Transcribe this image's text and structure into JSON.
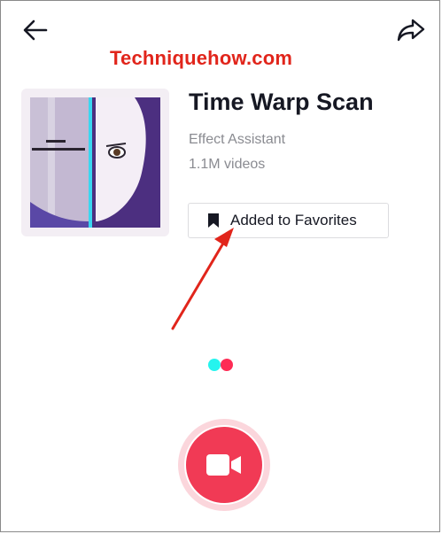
{
  "watermark": "Techniquehow.com",
  "effect": {
    "title": "Time Warp Scan",
    "creator": "Effect Assistant",
    "video_count": "1.1M videos"
  },
  "favorite_button": {
    "label": "Added to Favorites",
    "state": "added"
  },
  "icons": {
    "back": "arrow-left-icon",
    "share": "share-icon",
    "bookmark": "bookmark-filled-icon",
    "record": "video-camera-icon"
  },
  "colors": {
    "accent": "#fe2c55",
    "loader_cyan": "#25f4ee",
    "loader_pink": "#fe2c55",
    "annotation": "#e1251b"
  }
}
